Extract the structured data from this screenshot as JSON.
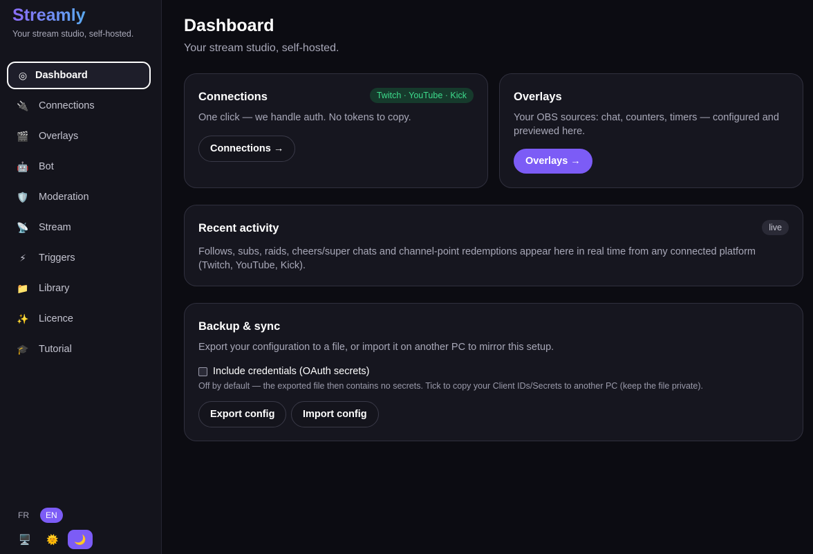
{
  "brand": {
    "name": "Streamly",
    "tagline": "Your stream studio, self-hosted."
  },
  "sidebar": {
    "items": [
      {
        "label": "Dashboard",
        "icon": "◎",
        "active": true
      },
      {
        "label": "Connections",
        "icon": "🔌"
      },
      {
        "label": "Overlays",
        "icon": "🎬"
      },
      {
        "label": "Bot",
        "icon": "🤖"
      },
      {
        "label": "Moderation",
        "icon": "🛡️"
      },
      {
        "label": "Stream",
        "icon": "📡"
      },
      {
        "label": "Triggers",
        "icon": "⚡"
      },
      {
        "label": "Library",
        "icon": "📁"
      },
      {
        "label": "Licence",
        "icon": "✨"
      },
      {
        "label": "Tutorial",
        "icon": "🎓"
      }
    ],
    "lang": {
      "fr": "FR",
      "en": "EN",
      "active": "EN"
    },
    "themes": {
      "system_icon": "🖥️",
      "light_icon": "🌞",
      "dark_icon": "🌙",
      "active": "dark"
    }
  },
  "header": {
    "title": "Dashboard",
    "subtitle": "Your stream studio, self-hosted."
  },
  "connections": {
    "title": "Connections",
    "badge": "Twitch · YouTube · Kick",
    "text": "One click — we handle auth. No tokens to copy.",
    "button": "Connections →"
  },
  "overlays": {
    "title": "Overlays",
    "text": "Your OBS sources: chat, counters, timers — configured and previewed here.",
    "button": "Overlays →"
  },
  "activity": {
    "title": "Recent activity",
    "badge": "live",
    "text": "Follows, subs, raids, cheers/super chats and channel-point redemptions appear here in real time from any connected platform (Twitch, YouTube, Kick)."
  },
  "backup": {
    "title": "Backup & sync",
    "text": "Export your configuration to a file, or import it on another PC to mirror this setup.",
    "checkbox_label": "Include credentials (OAuth secrets)",
    "checkbox_checked": false,
    "hint": "Off by default — the exported file then contains no secrets. Tick to copy your Client IDs/Secrets to another PC (keep the file private).",
    "export_button": "Export config",
    "import_button": "Import config"
  },
  "colors": {
    "accent": "#7c5cf6",
    "success": "#3ddc8c",
    "background": "#0c0c12",
    "card": "#16161f"
  }
}
